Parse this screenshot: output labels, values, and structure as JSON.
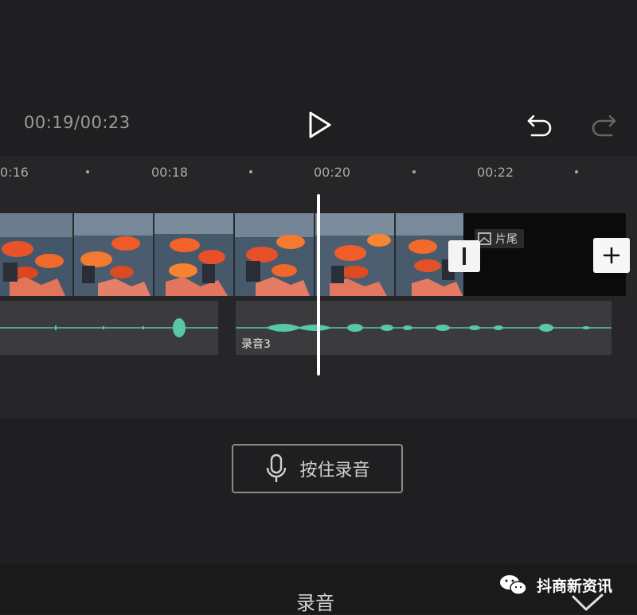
{
  "player": {
    "time_display": "00:19/00:23"
  },
  "icons": {
    "play": "play-icon",
    "undo": "undo-icon",
    "redo": "redo-icon",
    "mic": "microphone-icon",
    "add": "plus-icon",
    "confirm": "checkmark-icon",
    "wechat": "wechat-logo-icon"
  },
  "ruler": {
    "labels": [
      "0:16",
      "00:18",
      "00:20",
      "00:22"
    ]
  },
  "tracks": {
    "end_clip_label": "片尾",
    "audio_clip_label": "录音3"
  },
  "record": {
    "button_label": "按住录音"
  },
  "footer": {
    "title": "录音",
    "watermark": "抖商新资讯"
  },
  "colors": {
    "background": "#1f1f21",
    "waveform": "#58c7a8",
    "playhead": "#ffffff"
  }
}
